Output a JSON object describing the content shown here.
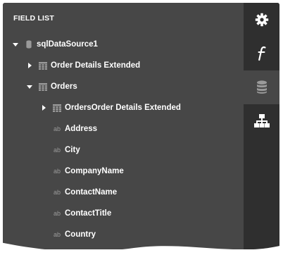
{
  "panel": {
    "title": "FIELD LIST"
  },
  "tree": {
    "datasource": "sqlDataSource1",
    "order_details_extended": "Order Details Extended",
    "orders": "Orders",
    "orders_order_details_extended": "OrdersOrder Details Extended",
    "field_type_glyph": "ab",
    "fields": [
      "Address",
      "City",
      "CompanyName",
      "ContactName",
      "ContactTitle",
      "Country"
    ]
  },
  "sidebar": {
    "items": [
      {
        "icon": "gear-icon"
      },
      {
        "icon": "function-icon"
      },
      {
        "icon": "database-icon",
        "active": true
      },
      {
        "icon": "hierarchy-icon"
      }
    ]
  }
}
